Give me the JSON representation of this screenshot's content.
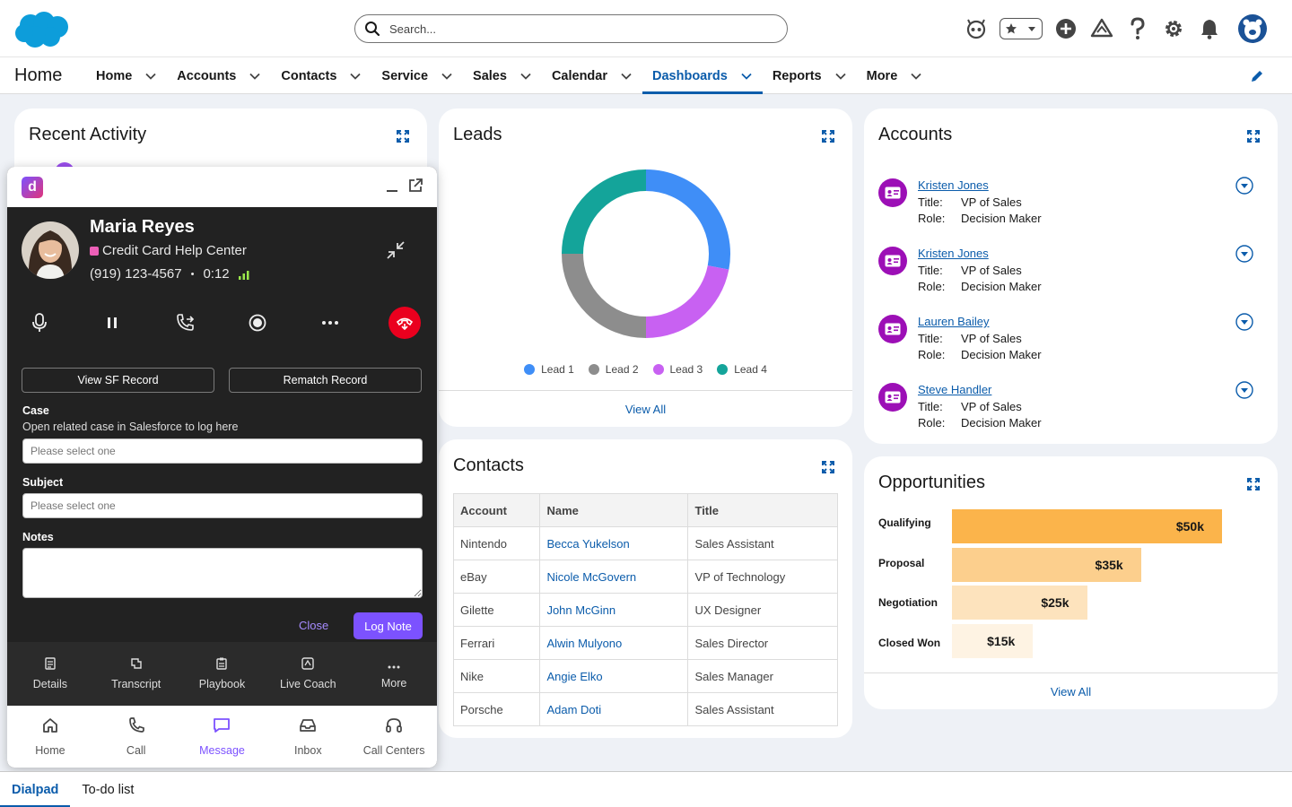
{
  "header": {
    "search_placeholder": "Search..."
  },
  "nav": {
    "app_name": "Home",
    "items": [
      {
        "label": "Home"
      },
      {
        "label": "Accounts"
      },
      {
        "label": "Contacts"
      },
      {
        "label": "Service"
      },
      {
        "label": "Sales"
      },
      {
        "label": "Calendar"
      },
      {
        "label": "Dashboards",
        "active": true
      },
      {
        "label": "Reports"
      },
      {
        "label": "More"
      }
    ]
  },
  "recent_activity": {
    "title": "Recent Activity"
  },
  "leads": {
    "title": "Leads",
    "view_all": "View All",
    "legend": [
      "Lead 1",
      "Lead 2",
      "Lead 3",
      "Lead 4"
    ],
    "colors": [
      "#3f8ef7",
      "#8d8d8d",
      "#c861f2",
      "#14a49a"
    ]
  },
  "contacts": {
    "title": "Contacts",
    "headers": [
      "Account",
      "Name",
      "Title"
    ],
    "rows": [
      [
        "Nintendo",
        "Becca Yukelson",
        "Sales Assistant"
      ],
      [
        "eBay",
        "Nicole McGovern",
        "VP of Technology"
      ],
      [
        "Gilette",
        "John McGinn",
        "UX Designer"
      ],
      [
        "Ferrari",
        "Alwin Mulyono",
        "Sales Director"
      ],
      [
        "Nike",
        "Angie Elko",
        "Sales Manager"
      ],
      [
        "Porsche",
        "Adam Doti",
        "Sales Assistant"
      ]
    ]
  },
  "accounts": {
    "title": "Accounts",
    "title_key": "Title:",
    "role_key": "Role:",
    "items": [
      {
        "name": "Kristen Jones",
        "title": "VP of Sales",
        "role": "Decision Maker"
      },
      {
        "name": "Kristen Jones",
        "title": "VP of Sales",
        "role": "Decision Maker"
      },
      {
        "name": "Lauren Bailey",
        "title": "VP of Sales",
        "role": "Decision Maker"
      },
      {
        "name": "Steve Handler",
        "title": "VP of Sales",
        "role": "Decision Maker"
      }
    ]
  },
  "opportunities": {
    "title": "Opportunities",
    "view_all": "View All",
    "stages": [
      {
        "label": "Qualifying",
        "value_label": "$50k",
        "value": 50,
        "color": "#fbb44b"
      },
      {
        "label": "Proposal",
        "value_label": "$35k",
        "value": 35,
        "color": "#fccf8d"
      },
      {
        "label": "Negotiation",
        "value_label": "$25k",
        "value": 25,
        "color": "#fde3bd"
      },
      {
        "label": "Closed Won",
        "value_label": "$15k",
        "value": 15,
        "color": "#fef3e3"
      }
    ]
  },
  "dialpad": {
    "caller_name": "Maria Reyes",
    "call_center": "Credit Card Help Center",
    "phone": "(919) 123-4567",
    "separator": "•",
    "duration": "0:12",
    "view_sf_record": "View SF Record",
    "rematch_record": "Rematch Record",
    "case_label": "Case",
    "case_hint": "Open related case in Salesforce to log here",
    "case_placeholder": "Please select one",
    "subject_label": "Subject",
    "subject_placeholder": "Please select one",
    "notes_label": "Notes",
    "close": "Close",
    "log_note": "Log Note",
    "tabs": [
      "Details",
      "Transcript",
      "Playbook",
      "Live Coach",
      "More"
    ],
    "bottom_nav": [
      "Home",
      "Call",
      "Message",
      "Inbox",
      "Call Centers"
    ],
    "active_bottom": "Message"
  },
  "utility_bar": {
    "tabs": [
      "Dialpad",
      "To-do list"
    ]
  }
}
